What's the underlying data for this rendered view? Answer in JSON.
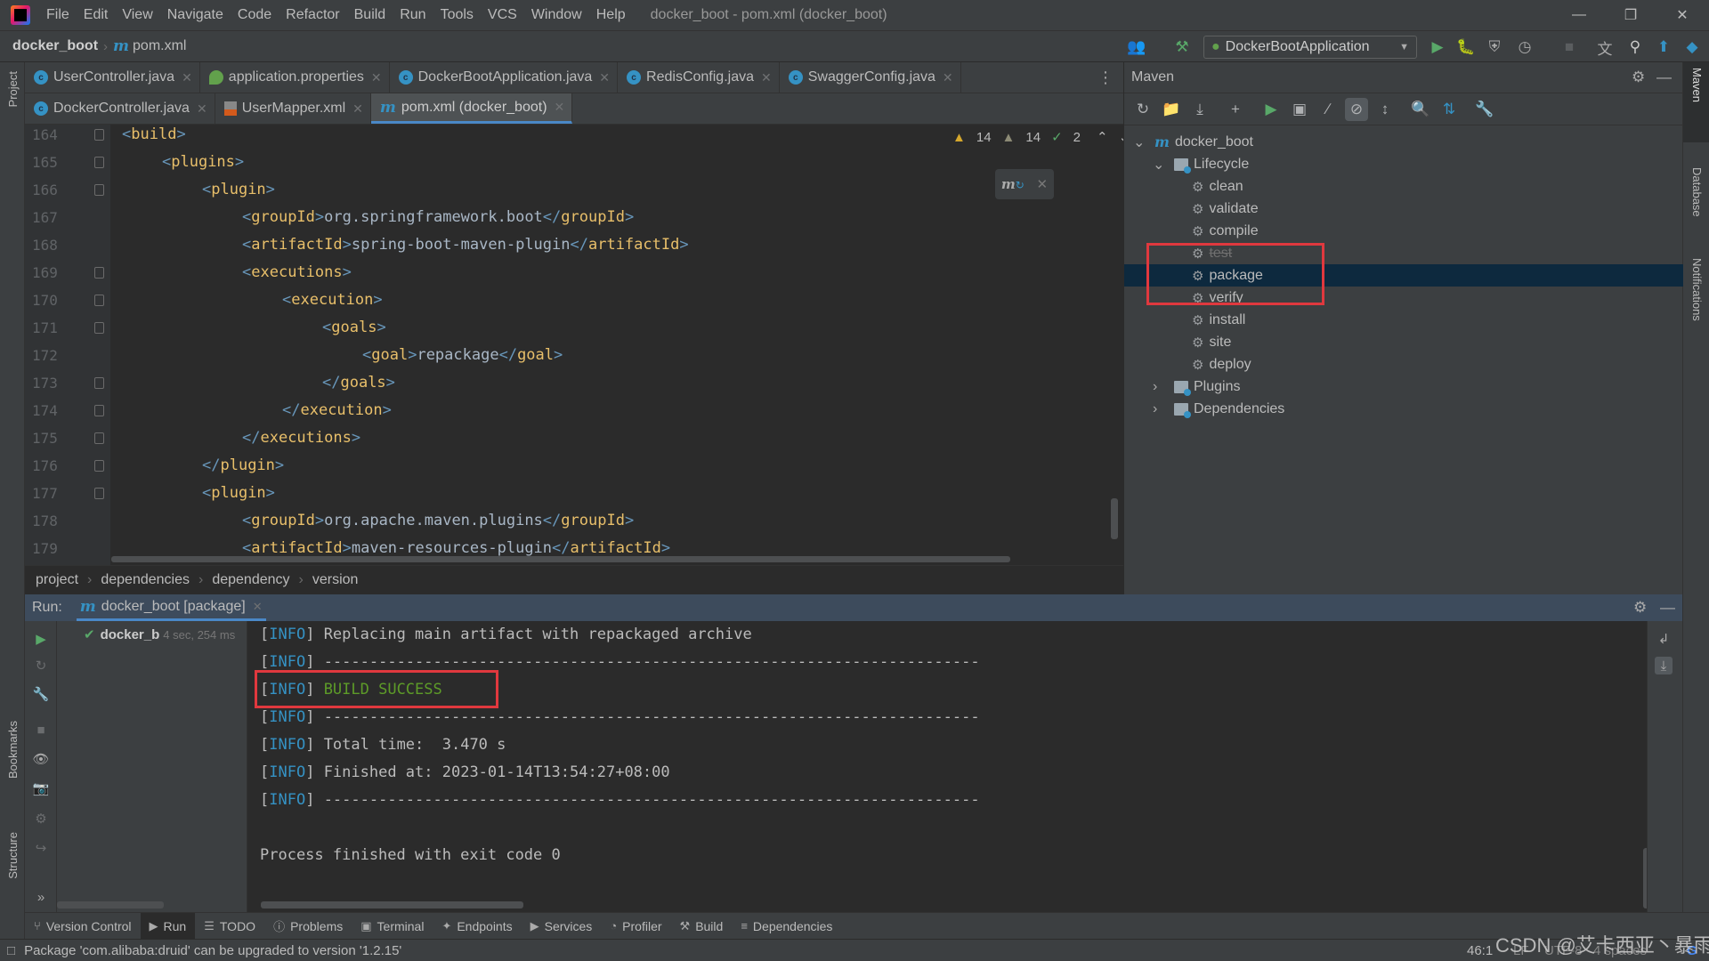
{
  "window": {
    "title": "docker_boot - pom.xml (docker_boot)",
    "menu": [
      "File",
      "Edit",
      "View",
      "Navigate",
      "Code",
      "Refactor",
      "Build",
      "Run",
      "Tools",
      "VCS",
      "Window",
      "Help"
    ]
  },
  "navbar": {
    "project": "docker_boot",
    "file": "pom.xml",
    "run_config": "DockerBootApplication"
  },
  "tabs_row1": [
    {
      "label": "UserController.java",
      "icon": "class-icon"
    },
    {
      "label": "application.properties",
      "icon": "spring-icon"
    },
    {
      "label": "DockerBootApplication.java",
      "icon": "spring-class-icon"
    },
    {
      "label": "RedisConfig.java",
      "icon": "class-icon"
    },
    {
      "label": "SwaggerConfig.java",
      "icon": "class-icon"
    }
  ],
  "tabs_row2": [
    {
      "label": "DockerController.java",
      "icon": "class-icon"
    },
    {
      "label": "UserMapper.xml",
      "icon": "xml-icon"
    },
    {
      "label": "pom.xml (docker_boot)",
      "icon": "maven-icon",
      "active": true
    }
  ],
  "editor": {
    "inspections": {
      "warnings": "14",
      "weak_warnings": "14",
      "typos": "2"
    },
    "lines": [
      {
        "n": "164",
        "indent": 0,
        "open": "build",
        "text": "",
        "close": ""
      },
      {
        "n": "165",
        "indent": 1,
        "open": "plugins",
        "text": "",
        "close": ""
      },
      {
        "n": "166",
        "indent": 2,
        "open": "plugin",
        "text": "",
        "close": ""
      },
      {
        "n": "167",
        "indent": 3,
        "open": "groupId",
        "text": "org.springframework.boot",
        "close": "groupId"
      },
      {
        "n": "168",
        "indent": 3,
        "open": "artifactId",
        "text": "spring-boot-maven-plugin",
        "close": "artifactId"
      },
      {
        "n": "169",
        "indent": 3,
        "open": "executions",
        "text": "",
        "close": ""
      },
      {
        "n": "170",
        "indent": 4,
        "open": "execution",
        "text": "",
        "close": ""
      },
      {
        "n": "171",
        "indent": 5,
        "open": "goals",
        "text": "",
        "close": ""
      },
      {
        "n": "172",
        "indent": 6,
        "open": "goal",
        "text": "repackage",
        "close": "goal"
      },
      {
        "n": "173",
        "indent": 5,
        "open": "",
        "text": "",
        "close": "goals"
      },
      {
        "n": "174",
        "indent": 4,
        "open": "",
        "text": "",
        "close": "execution"
      },
      {
        "n": "175",
        "indent": 3,
        "open": "",
        "text": "",
        "close": "executions"
      },
      {
        "n": "176",
        "indent": 2,
        "open": "",
        "text": "",
        "close": "plugin"
      },
      {
        "n": "177",
        "indent": 2,
        "open": "plugin",
        "text": "",
        "close": ""
      },
      {
        "n": "178",
        "indent": 3,
        "open": "groupId",
        "text": "org.apache.maven.plugins",
        "close": "groupId"
      },
      {
        "n": "179",
        "indent": 3,
        "open": "artifactId",
        "text": "maven-resources-plugin",
        "close": "artifactId"
      }
    ]
  },
  "breadcrumb": [
    "project",
    "dependencies",
    "dependency",
    "version"
  ],
  "maven": {
    "title": "Maven",
    "root": "docker_boot",
    "lifecycle_label": "Lifecycle",
    "lifecycle": [
      {
        "label": "clean"
      },
      {
        "label": "validate"
      },
      {
        "label": "compile"
      },
      {
        "label": "test",
        "disabled": true
      },
      {
        "label": "package",
        "selected": true
      },
      {
        "label": "verify"
      },
      {
        "label": "install"
      },
      {
        "label": "site"
      },
      {
        "label": "deploy"
      }
    ],
    "plugins_label": "Plugins",
    "dependencies_label": "Dependencies"
  },
  "right_strip": [
    "Maven",
    "Database",
    "Notifications"
  ],
  "left_strip": [
    "Project",
    "Bookmarks",
    "Structure"
  ],
  "run": {
    "label": "Run:",
    "tab": "docker_boot [package]",
    "tree_item": "docker_b",
    "tree_time": "4 sec, 254 ms",
    "console": [
      {
        "tag": "[INFO]",
        "text": " Replacing main artifact with repackaged archive",
        "style": "normal"
      },
      {
        "tag": "[INFO]",
        "text": " ------------------------------------------------------------------------",
        "style": "normal"
      },
      {
        "tag": "[INFO]",
        "text": " BUILD SUCCESS",
        "style": "success"
      },
      {
        "tag": "[INFO]",
        "text": " ------------------------------------------------------------------------",
        "style": "normal"
      },
      {
        "tag": "[INFO]",
        "text": " Total time:  3.470 s",
        "style": "normal"
      },
      {
        "tag": "[INFO]",
        "text": " Finished at: 2023-01-14T13:54:27+08:00",
        "style": "normal"
      },
      {
        "tag": "[INFO]",
        "text": " ------------------------------------------------------------------------",
        "style": "normal"
      },
      {
        "tag": "",
        "text": "",
        "style": "normal"
      },
      {
        "tag": "",
        "text": "Process finished with exit code 0",
        "style": "normal"
      }
    ]
  },
  "bottom_tools": [
    {
      "label": "Version Control",
      "icon": "vcs-icon"
    },
    {
      "label": "Run",
      "icon": "run-icon",
      "active": true
    },
    {
      "label": "TODO",
      "icon": "todo-icon"
    },
    {
      "label": "Problems",
      "icon": "problems-icon"
    },
    {
      "label": "Terminal",
      "icon": "terminal-icon"
    },
    {
      "label": "Endpoints",
      "icon": "endpoints-icon"
    },
    {
      "label": "Services",
      "icon": "services-icon"
    },
    {
      "label": "Profiler",
      "icon": "profiler-icon"
    },
    {
      "label": "Build",
      "icon": "build-icon"
    },
    {
      "label": "Dependencies",
      "icon": "dependencies-icon"
    }
  ],
  "status": {
    "message": "Package 'com.alibaba:druid' can be upgraded to version '1.2.15'",
    "position": "46:1",
    "line_sep": "LF",
    "encoding": "UTF-8",
    "indent": "4 spaces"
  },
  "watermark": "CSDN @艾卡西亚丶暴雨L",
  "colors": {
    "accent": "#4a88c7",
    "success": "#5d9b28",
    "info": "#3592c4",
    "highlight_box": "#e0383e",
    "selection": "#0d293e"
  }
}
